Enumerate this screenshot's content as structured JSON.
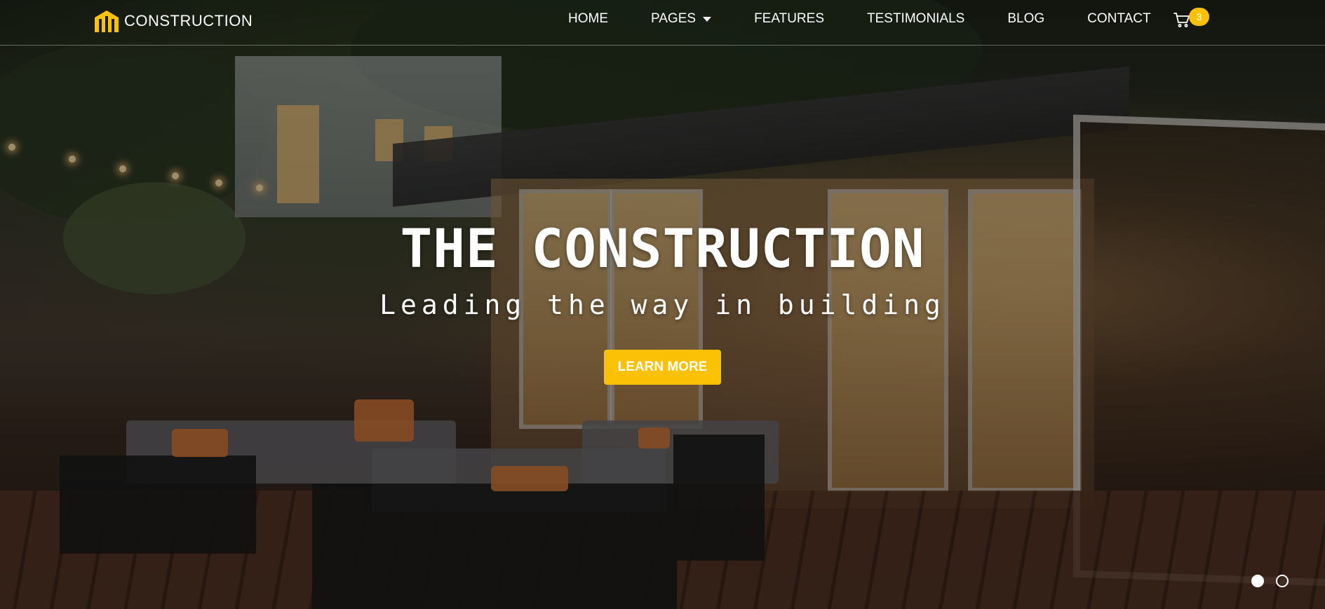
{
  "brand": {
    "name": "CONSTRUCTION",
    "logo_icon": "building-columns-icon",
    "accent_color": "#fbc107"
  },
  "nav": {
    "items": [
      {
        "label": "HOME"
      },
      {
        "label": "PAGES",
        "has_dropdown": true
      },
      {
        "label": "FEATURES"
      },
      {
        "label": "TESTIMONIALS"
      },
      {
        "label": "BLOG"
      },
      {
        "label": "CONTACT"
      }
    ],
    "cart": {
      "icon": "cart-icon",
      "count": "3"
    }
  },
  "hero": {
    "title": "THE CONSTRUCTION",
    "subtitle": "Leading the way in building",
    "button_label": "LEARN MORE"
  },
  "carousel": {
    "slide_count": 2,
    "active_index": 0
  }
}
